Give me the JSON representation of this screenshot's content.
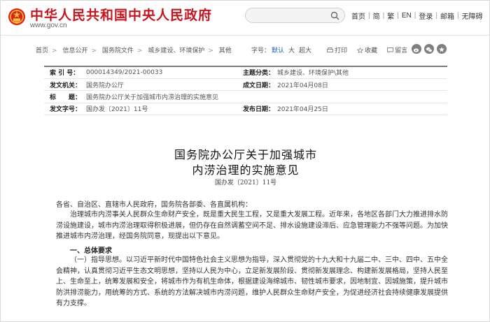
{
  "header": {
    "site_title": "中华人民共和国中央人民政府",
    "site_url": "www.gov.cn",
    "links": [
      "首页",
      "简",
      "繁",
      "EN",
      "登录",
      "邮箱",
      "无障碍"
    ],
    "colors": {
      "brand": "#c9151e"
    }
  },
  "breadcrumb": {
    "items": [
      "首页",
      "信息公开",
      "国务院文件",
      "城乡建设、环境保护",
      "其他"
    ],
    "font_label": "字号：",
    "font_default": "默认",
    "font_large": "大",
    "font_super": "超大",
    "print": "打印",
    "favorite": "收藏",
    "leave_msg": "留言"
  },
  "info": {
    "index_label": "索 引 号：",
    "index_value": "000014349/2021-00033",
    "category_label": "主题分类：",
    "category_value": "城乡建设、环境保护\\其他",
    "issuer_label": "发文机关：",
    "issuer_value": "国务院办公厅",
    "written_label": "成文日期：",
    "written_value": "2021年04月08日",
    "title_label": "标　　题：",
    "title_value": "国务院办公厅关于加强城市内涝治理的实施意见",
    "docno_label": "发文字号：",
    "docno_value": "国办发〔2021〕11号",
    "publish_label": "发布日期：",
    "publish_value": "2021年04月25日"
  },
  "document": {
    "title_line1": "国务院办公厅关于加强城市",
    "title_line2": "内涝治理的实施意见",
    "number": "国办发〔2021〕11号",
    "salutation": "各省、自治区、直辖市人民政府，国务院各部委、各直属机构：",
    "para1": "治理城市内涝事关人民群众生命财产安全，既是重大民生工程，又是重大发展工程。近年来，各地区各部门大力推进排水防涝设施建设，城市内涝治理取得积极进展，但仍存在自然调蓄空间不足、排水设施建设滞后、应急管理能力不强等问题。为加快推进城市内涝治理，经国务院同意，现提出以下意见。",
    "section1": "一、总体要求",
    "para2": "（一）指导思想。以习近平新时代中国特色社会主义思想为指导，深入贯彻党的十九大和十九届二中、三中、四中、五中全会精神，认真贯彻习近平生态文明思想，坚持以人民为中心，立足新发展阶段、贯彻新发展理念、构建新发展格局，坚持人民至上、生命至上，统筹发展和安全，将城市作为有机生命体，根据建设海绵城市、韧性城市要求，因地制宜、因城施策，提升城市防洪排涝能力，用统筹的方式、系统的方法解决城市内涝问题，维护人民群众生命财产安全，为促进经济社会持续健康发展提供有力支撑。"
  }
}
